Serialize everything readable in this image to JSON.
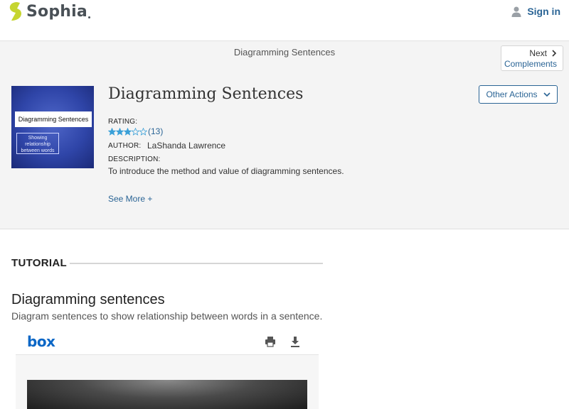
{
  "header": {
    "brand": "Sophia",
    "signin_label": "Sign in"
  },
  "breadcrumb": {
    "title": "Diagramming Sentences",
    "next_label": "Next",
    "next_target": "Complements"
  },
  "resource": {
    "thumbnail_title": "Diagramming Sentences",
    "thumbnail_subtitle": "Showing relationship between words",
    "title": "Diagramming Sentences",
    "other_actions_label": "Other Actions",
    "rating_label": "RATING:",
    "rating_stars": 3,
    "rating_max": 5,
    "rating_count": "(13)",
    "author_label": "AUTHOR:",
    "author_name": "LaShanda Lawrence",
    "description_label": "DESCRIPTION:",
    "description": "To introduce the method and value of diagramming sentences.",
    "see_more_label": "See More +"
  },
  "tutorial": {
    "section_label": "TUTORIAL",
    "heading": "Diagramming sentences",
    "description": "Diagram sentences to show relationship between words in a sentence."
  },
  "viewer": {
    "brand": "box",
    "icons": [
      "print-icon",
      "download-icon"
    ]
  },
  "colors": {
    "link": "#2a6495",
    "brand_green": "#c6d530",
    "box_blue": "#0b67c6",
    "star": "#3aa0d8"
  }
}
